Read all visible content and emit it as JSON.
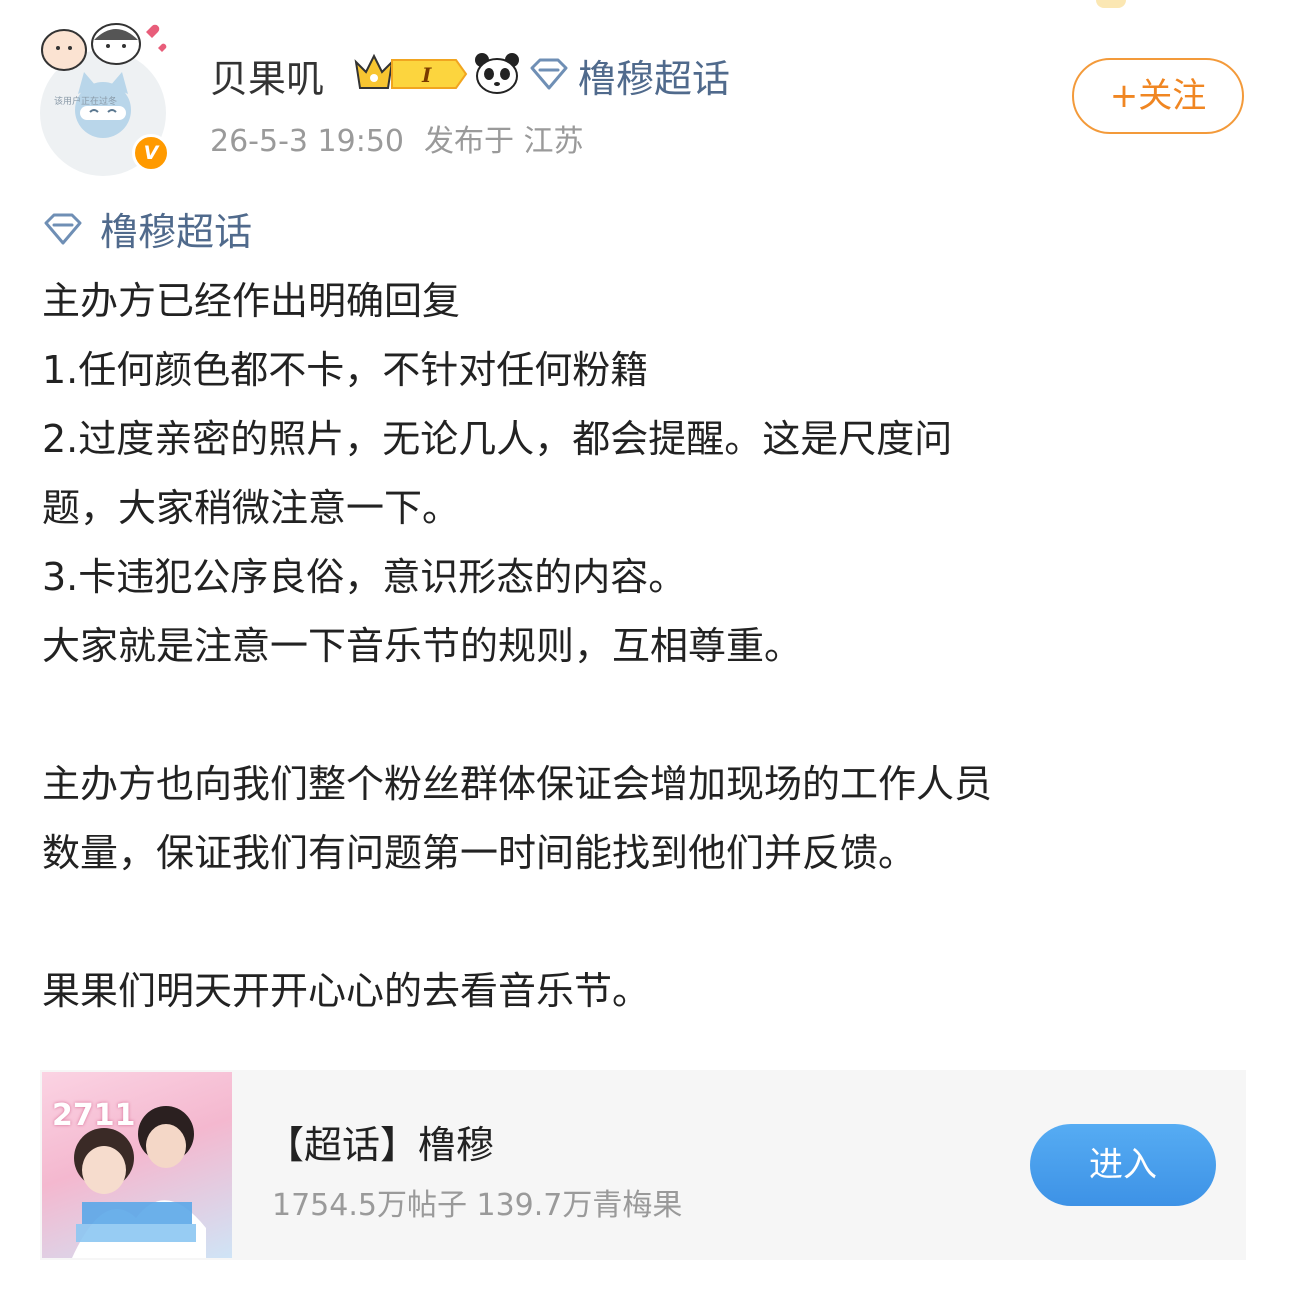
{
  "header": {
    "username": "贝果叽",
    "topic": "橹穆超话",
    "timestamp": "26-5-3 19:50",
    "location": "发布于 江苏",
    "follow_label": "+关注",
    "avatar_caption": "该用户正在过冬",
    "verified_badge": "V",
    "level_badge": "I",
    "icons": [
      "crown-level-icon",
      "panda-icon",
      "diamond-topic-icon"
    ]
  },
  "post": {
    "topic_tag": "橹穆超话",
    "lines": [
      "主办方已经作出明确回复",
      "1.任何颜色都不卡，不针对任何粉籍",
      "2.过度亲密的照片，无论几人，都会提醒。这是尺度问",
      "题，大家稍微注意一下。",
      "3.卡违犯公序良俗，意识形态的内容。",
      "大家就是注意一下音乐节的规则，互相尊重。",
      "",
      "主办方也向我们整个粉丝群体保证会增加现场的工作人员",
      "数量，保证我们有问题第一时间能找到他们并反馈。",
      "",
      "果果们明天开开心心的去看音乐节。"
    ]
  },
  "card": {
    "title": "【超话】橹穆",
    "stats": "1754.5万帖子 139.7万青梅果",
    "cover_number": "2711",
    "enter_label": "进入"
  },
  "colors": {
    "link": "#506a8c",
    "follow": "#f08622",
    "enter_button": "#4a9fee",
    "meta": "#9a9a9a"
  }
}
